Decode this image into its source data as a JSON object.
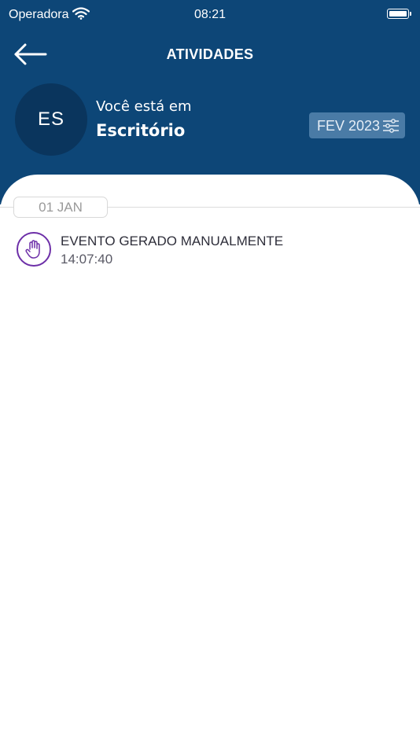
{
  "status_bar": {
    "carrier": "Operadora",
    "time": "08:21",
    "wifi_icon": "wifi-icon",
    "battery_icon": "battery-icon"
  },
  "header": {
    "title": "ATIVIDADES",
    "back_icon": "arrow-left-icon",
    "background_color": "#0d4677"
  },
  "profile": {
    "initials": "ES",
    "caption": "Você está em",
    "location": "Escritório"
  },
  "filter": {
    "month": "FEV 2023",
    "icon": "sliders-icon"
  },
  "activities": {
    "groups": [
      {
        "date": "01 JAN",
        "events": [
          {
            "title": "EVENTO GERADO MANUALMENTE",
            "time": "14:07:40",
            "icon": "hand-icon",
            "icon_color": "#6d2fa8"
          }
        ]
      }
    ]
  }
}
